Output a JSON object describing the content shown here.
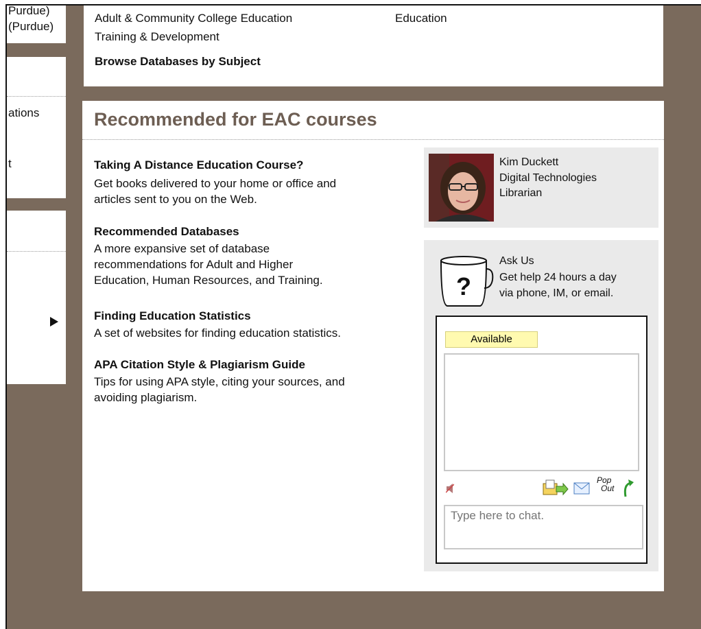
{
  "left_fragments": {
    "purdue_1": "Purdue)",
    "purdue_2": "(Purdue)",
    "ations": "ations",
    "t_frag": "t"
  },
  "top_links": {
    "adult_education": "Adult & Community College Education",
    "education": "Education",
    "training": "Training & Development",
    "browse": "Browse Databases by Subject"
  },
  "main": {
    "heading": "Recommended for EAC courses",
    "items": [
      {
        "title": "Taking A Distance Education Course?",
        "desc_lines": [
          "Get books delivered to your home or office and",
          "articles sent to you on the Web."
        ]
      },
      {
        "title": "Recommended Databases",
        "desc_lines": [
          "A more expansive set of database",
          "recommendations for Adult and Higher",
          "Education, Human Resources, and Training."
        ]
      },
      {
        "title": "Finding Education Statistics",
        "desc_lines": [
          "A set of websites for finding education statistics."
        ]
      },
      {
        "title": "APA Citation Style & Plagiarism Guide",
        "desc_lines": [
          "Tips for using APA style, citing your sources, and",
          "avoiding plagiarism."
        ]
      }
    ]
  },
  "librarian": {
    "name": "Kim Duckett",
    "title_line1": "Digital Technologies",
    "title_line2": "Librarian"
  },
  "ask_us": {
    "title": "Ask Us",
    "line1": "Get help 24 hours a day",
    "line2": "via phone, IM, or email."
  },
  "chat": {
    "status": "Available",
    "input_value": "Type here to chat.",
    "popout_line1": "Pop",
    "popout_line2": "Out"
  },
  "colors": {
    "background": "#7a6a5c",
    "link": "#1e5fb3",
    "heading": "#6d5e53",
    "panel": "#eaeaea",
    "status": "#fffab0"
  }
}
